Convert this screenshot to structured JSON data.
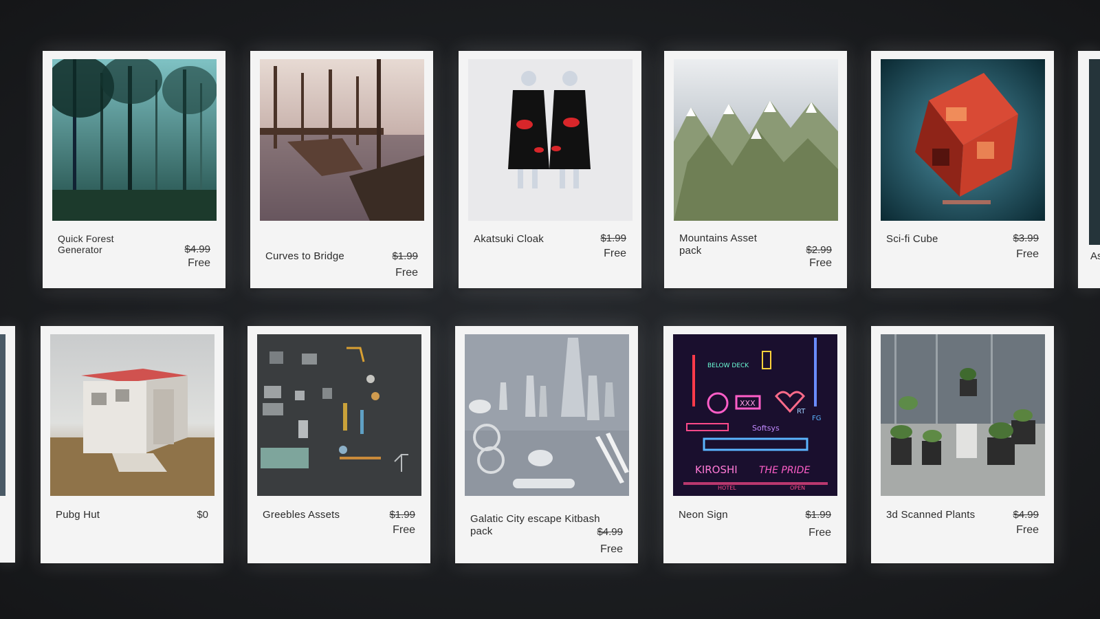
{
  "cards_row1": [
    {
      "title": "Quick Forest Generator",
      "old_price": "$4.99",
      "new_price": "Free"
    },
    {
      "title": "Curves to Bridge",
      "old_price": "$1.99",
      "new_price": "Free"
    },
    {
      "title": "Akatsuki Cloak",
      "old_price": "$1.99",
      "new_price": "Free"
    },
    {
      "title": "Mountains Asset pack",
      "old_price": "$2.99",
      "new_price": "Free"
    },
    {
      "title": "Sci-fi Cube",
      "old_price": "$3.99",
      "new_price": "Free"
    }
  ],
  "cards_row2": [
    {
      "title": "Pubg Hut",
      "price": "$0"
    },
    {
      "title": "Greebles Assets",
      "old_price": "$1.99",
      "new_price": "Free"
    },
    {
      "title": "Galatic City escape Kitbash pack",
      "old_price": "$4.99",
      "new_price": "Free"
    },
    {
      "title": "Neon Sign",
      "old_price": "$1.99",
      "new_price": "Free"
    },
    {
      "title": "3d Scanned Plants",
      "old_price": "$4.99",
      "new_price": "Free"
    }
  ],
  "peek_right_text": "As",
  "neon_texts": [
    "BELOW DECK",
    "Softsys",
    "XXX",
    "KIROSHI",
    "THE PRIDE",
    "RT",
    "FG",
    "OPEN",
    "HOTEL"
  ]
}
